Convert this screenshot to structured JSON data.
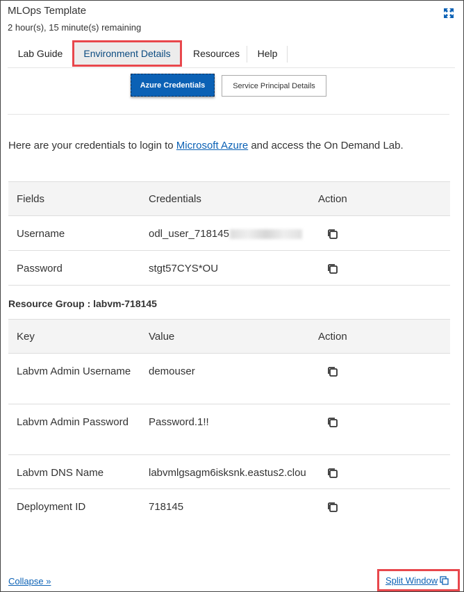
{
  "header": {
    "title": "MLOps Template",
    "remaining": "2 hour(s), 15 minute(s) remaining"
  },
  "tabs": [
    {
      "label": "Lab Guide"
    },
    {
      "label": "Environment Details",
      "active": true
    },
    {
      "label": "Resources"
    },
    {
      "label": "Help"
    }
  ],
  "sub_tabs": {
    "azure": "Azure Credentials",
    "service_principal": "Service Principal Details"
  },
  "intro": {
    "before": "Here are your credentials to login to ",
    "link": "Microsoft Azure",
    "after": " and access the On Demand Lab."
  },
  "credentials_table": {
    "headers": [
      "Fields",
      "Credentials",
      "Action"
    ],
    "rows": [
      {
        "field": "Username",
        "value": "odl_user_718145"
      },
      {
        "field": "Password",
        "value": "stgt57CYS*OU"
      }
    ]
  },
  "resource_group": "Resource Group : labvm-718145",
  "resource_table": {
    "headers": [
      "Key",
      "Value",
      "Action"
    ],
    "rows": [
      {
        "key": "Labvm Admin Username",
        "value": "demouser"
      },
      {
        "key": "Labvm Admin Password",
        "value": "Password.1!!"
      },
      {
        "key": "Labvm DNS Name",
        "value": "labvmlgsagm6isksnk.eastus2.clou"
      },
      {
        "key": "Deployment ID",
        "value": "718145"
      }
    ]
  },
  "footer": {
    "collapse": "Collapse »",
    "split_window": "Split Window"
  },
  "colors": {
    "accent": "#0b61b5",
    "highlight": "#e8474c"
  },
  "icons": {
    "expand": "expand-icon",
    "copy": "copy-icon",
    "split": "split-window-icon"
  }
}
